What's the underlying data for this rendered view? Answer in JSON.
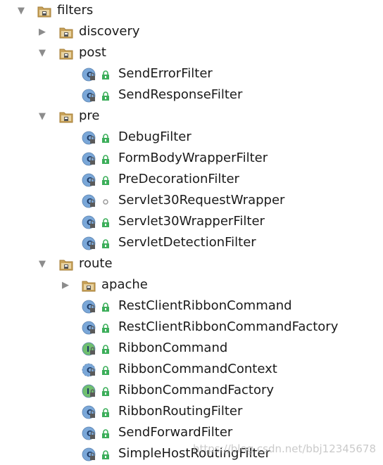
{
  "tree": [
    {
      "kind": "folder",
      "depth": 0,
      "expanded": true,
      "label": "filters"
    },
    {
      "kind": "folder",
      "depth": 1,
      "expanded": false,
      "label": "discovery"
    },
    {
      "kind": "folder",
      "depth": 1,
      "expanded": true,
      "label": "post"
    },
    {
      "kind": "class",
      "depth": 2,
      "visibility": "public",
      "label": "SendErrorFilter"
    },
    {
      "kind": "class",
      "depth": 2,
      "visibility": "public",
      "label": "SendResponseFilter"
    },
    {
      "kind": "folder",
      "depth": 1,
      "expanded": true,
      "label": "pre"
    },
    {
      "kind": "class",
      "depth": 2,
      "visibility": "public",
      "label": "DebugFilter"
    },
    {
      "kind": "class",
      "depth": 2,
      "visibility": "public",
      "label": "FormBodyWrapperFilter"
    },
    {
      "kind": "class",
      "depth": 2,
      "visibility": "public",
      "label": "PreDecorationFilter"
    },
    {
      "kind": "class",
      "depth": 2,
      "visibility": "package",
      "label": "Servlet30RequestWrapper"
    },
    {
      "kind": "class",
      "depth": 2,
      "visibility": "public",
      "label": "Servlet30WrapperFilter"
    },
    {
      "kind": "class",
      "depth": 2,
      "visibility": "public",
      "label": "ServletDetectionFilter"
    },
    {
      "kind": "folder",
      "depth": 1,
      "expanded": true,
      "label": "route"
    },
    {
      "kind": "folder",
      "depth": 2,
      "expanded": false,
      "label": "apache"
    },
    {
      "kind": "class",
      "depth": 2,
      "visibility": "public",
      "label": "RestClientRibbonCommand"
    },
    {
      "kind": "class",
      "depth": 2,
      "visibility": "public",
      "label": "RestClientRibbonCommandFactory"
    },
    {
      "kind": "interface",
      "depth": 2,
      "visibility": "public",
      "label": "RibbonCommand"
    },
    {
      "kind": "abstract-class",
      "depth": 2,
      "visibility": "public",
      "label": "RibbonCommandContext"
    },
    {
      "kind": "interface",
      "depth": 2,
      "visibility": "public",
      "label": "RibbonCommandFactory"
    },
    {
      "kind": "class",
      "depth": 2,
      "visibility": "public",
      "label": "RibbonRoutingFilter"
    },
    {
      "kind": "class",
      "depth": 2,
      "visibility": "public",
      "label": "SendForwardFilter"
    },
    {
      "kind": "class",
      "depth": 2,
      "visibility": "public",
      "label": "SimpleHostRoutingFilter"
    }
  ],
  "watermark": "https://blog.csdn.net/bbj12345678",
  "colors": {
    "folder": "#c8a25a",
    "class_circle": "#7aa7d8",
    "interface_circle": "#6fbf6f",
    "public_lock": "#3cae5a",
    "package_dot": "#9a9a9a"
  }
}
